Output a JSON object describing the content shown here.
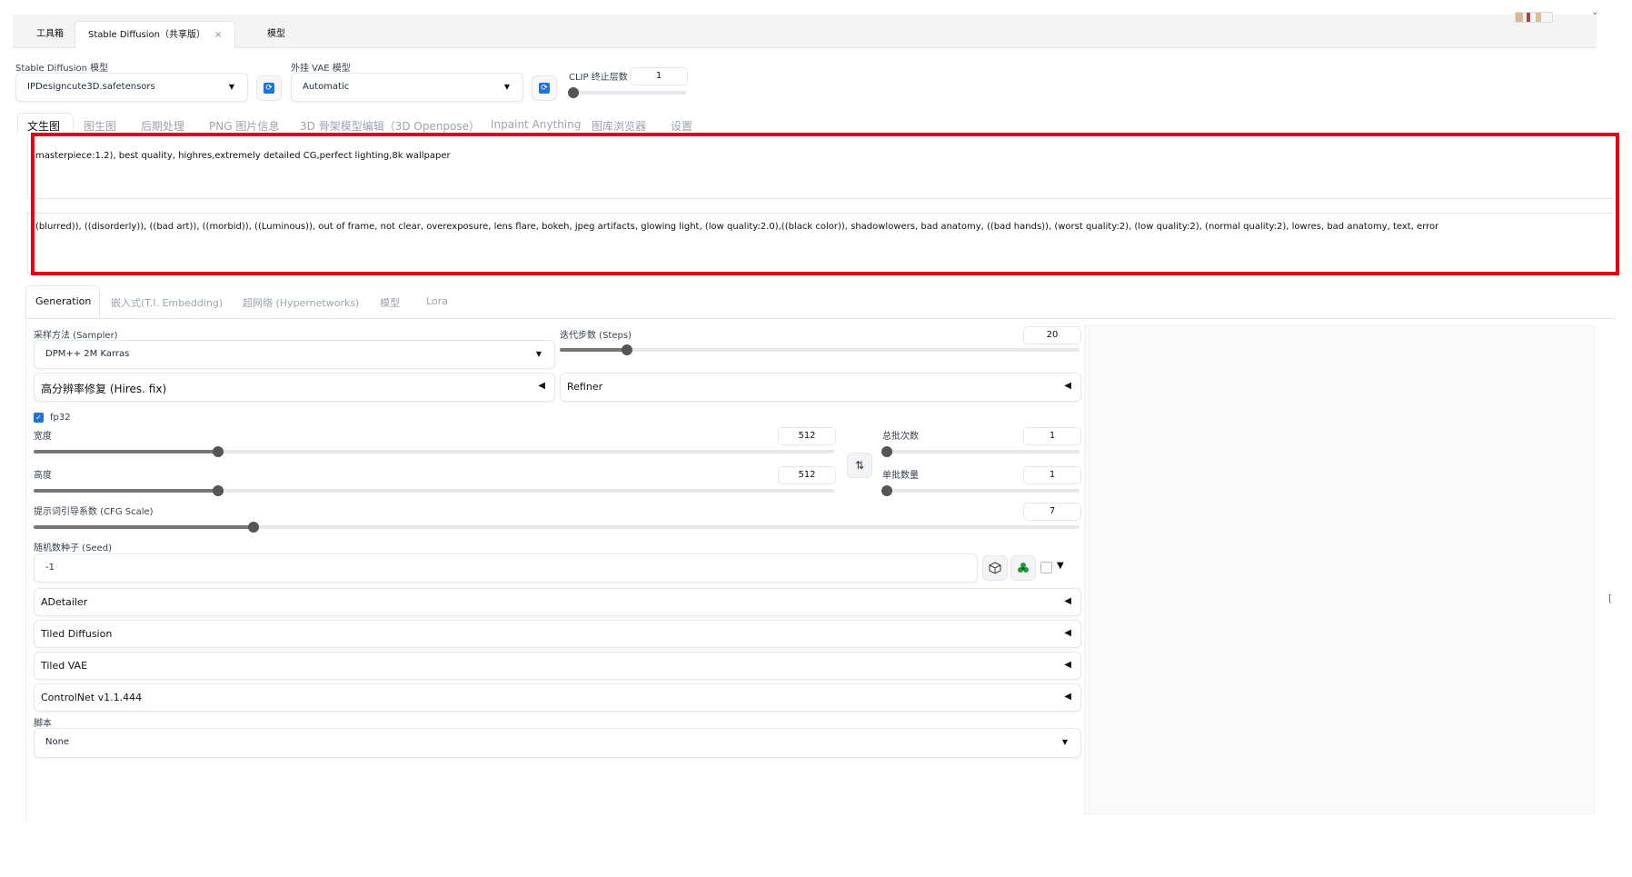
{
  "top_tabs": [
    {
      "label": "工具箱"
    },
    {
      "label": "Stable Diffusion（共享版）",
      "close": "×"
    },
    {
      "label": "模型"
    }
  ],
  "models": {
    "sd_label": "Stable Diffusion 模型",
    "sd_value": "IPDesigncute3D.safetensors",
    "vae_label": "外挂 VAE 模型",
    "vae_value": "Automatic",
    "clip_label": "CLIP 终止层数",
    "clip_value": "1",
    "clip_slider": 0.0
  },
  "main_tabs": [
    "文生图",
    "图生图",
    "后期处理",
    "PNG 图片信息",
    "3D 骨架模型编辑（3D Openpose）",
    "Inpaint Anything",
    "图库浏览器",
    "设置"
  ],
  "prompt": {
    "positive": "masterpiece:1.2), best quality, highres,extremely detailed CG,perfect lighting,8k wallpaper",
    "negative": "(blurred)), ((disorderly)), ((bad art)), ((morbid)), ((Luminous)), out of frame, not clear, overexposure, lens flare, bokeh, jpeg artifacts, glowing light, (low quality:2.0),((black color)), shadowlowers, bad anatomy, ((bad hands)), (worst quality:2), (low quality:2), (normal quality:2), lowres, bad anatomy, text, error"
  },
  "sub_tabs": [
    "Generation",
    "嵌入式(T.I. Embedding)",
    "超网络 (Hypernetworks)",
    "模型",
    "Lora"
  ],
  "sampler": {
    "label": "采样方法 (Sampler)",
    "value": "DPM++ 2M Karras"
  },
  "steps": {
    "label": "迭代步数 (Steps)",
    "value": "20",
    "fraction": 0.13
  },
  "hires_label": "高分辨率修复 (Hires. fix)",
  "refiner_label": "Refiner",
  "fp32_label": "fp32",
  "width": {
    "label": "宽度",
    "value": "512",
    "fraction": 0.23
  },
  "height": {
    "label": "高度",
    "value": "512",
    "fraction": 0.23
  },
  "batch_count": {
    "label": "总批次数",
    "value": "1",
    "fraction": 0.0
  },
  "batch_size": {
    "label": "单批数量",
    "value": "1",
    "fraction": 0.0
  },
  "cfg": {
    "label": "提示词引导系数 (CFG Scale)",
    "value": "7",
    "fraction": 0.21
  },
  "seed": {
    "label": "随机数种子 (Seed)",
    "value": "-1"
  },
  "accordions": [
    "ADetailer",
    "Tiled Diffusion",
    "Tiled VAE",
    "ControlNet v1.1.444"
  ],
  "script": {
    "label": "脚本",
    "value": "None"
  },
  "icons": {
    "swap": "⇅",
    "dice": "dice-icon",
    "recycle": "recycle-icon",
    "arrow": "◀",
    "caret": "▼"
  }
}
